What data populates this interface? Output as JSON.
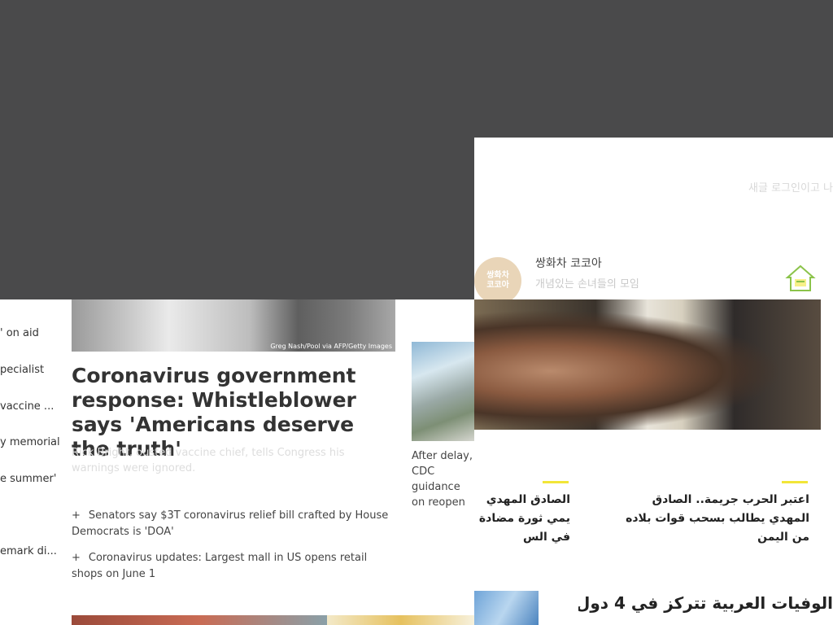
{
  "news": {
    "left_list": [
      "' on aid",
      "pecialist",
      "vaccine ...",
      "y memorial",
      "e summer'",
      "emark di..."
    ],
    "photo_credit": "Greg Nash/Pool via AFP/Getty Images",
    "headline": "Coronavirus government response: Whistleblower says 'Americans deserve the truth'",
    "subhead": "Rick Bright, ousted vaccine chief, tells Congress his warnings were ignored.",
    "bullets": [
      "Senators say $3T coronavirus relief bill crafted by House Democrats is 'DOA'",
      "Coronavirus updates: Largest mall in US opens retail shops on June 1"
    ],
    "side_story": "After delay, CDC guidance on reopen"
  },
  "popup": {
    "login_hint": "새글 로그인이고 나",
    "cafe": {
      "name": "쌍화차 코코아",
      "description": "개념있는 손녀들의 모임",
      "logo_text": "쌍화차\n코코아"
    },
    "arabic_news": {
      "story_left": "الصادق المهدي يمي ثورة مضادة في الس",
      "story_right": "اعتبر الحرب جريمة.. الصادق المهدي يطالب بسحب قوات بلاده من اليمن",
      "big_title": "الوفيات العربية تتركز في 4 دول.."
    },
    "colors": {
      "accent_yellow": "#f2e638",
      "overlay": "#4a4a4b"
    }
  }
}
